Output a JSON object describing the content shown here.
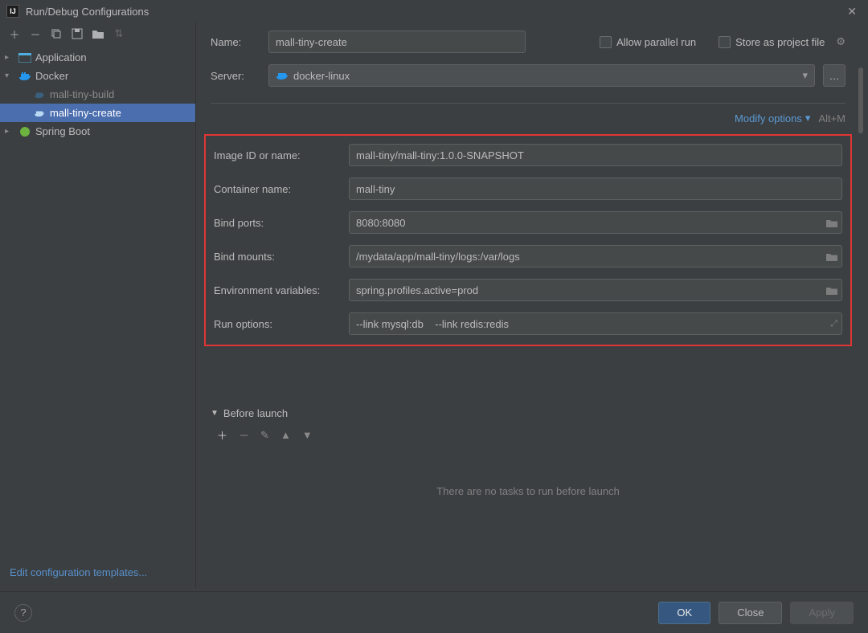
{
  "window": {
    "title": "Run/Debug Configurations"
  },
  "tree": {
    "application": {
      "label": "Application"
    },
    "docker": {
      "label": "Docker"
    },
    "docker_children": [
      {
        "label": "mall-tiny-build"
      },
      {
        "label": "mall-tiny-create"
      }
    ],
    "spring_boot": {
      "label": "Spring Boot"
    }
  },
  "sidebar": {
    "edit_templates": "Edit configuration templates..."
  },
  "form": {
    "name_label": "Name:",
    "name_value": "mall-tiny-create",
    "allow_parallel": "Allow parallel run",
    "store_as_file": "Store as project file",
    "server_label": "Server:",
    "server_value": "docker-linux",
    "modify_options": "Modify options",
    "modify_shortcut": "Alt+M",
    "image_label": "Image ID or name:",
    "image_value": "mall-tiny/mall-tiny:1.0.0-SNAPSHOT",
    "container_label": "Container name:",
    "container_value": "mall-tiny",
    "bind_ports_label": "Bind ports:",
    "bind_ports_value": "8080:8080",
    "bind_mounts_label": "Bind mounts:",
    "bind_mounts_value": "/mydata/app/mall-tiny/logs:/var/logs",
    "env_label": "Environment variables:",
    "env_value": "spring.profiles.active=prod",
    "runopt_label": "Run options:",
    "runopt_value": "--link mysql:db    --link redis:redis"
  },
  "before_launch": {
    "title": "Before launch",
    "empty": "There are no tasks to run before launch"
  },
  "buttons": {
    "ok": "OK",
    "close": "Close",
    "apply": "Apply"
  }
}
